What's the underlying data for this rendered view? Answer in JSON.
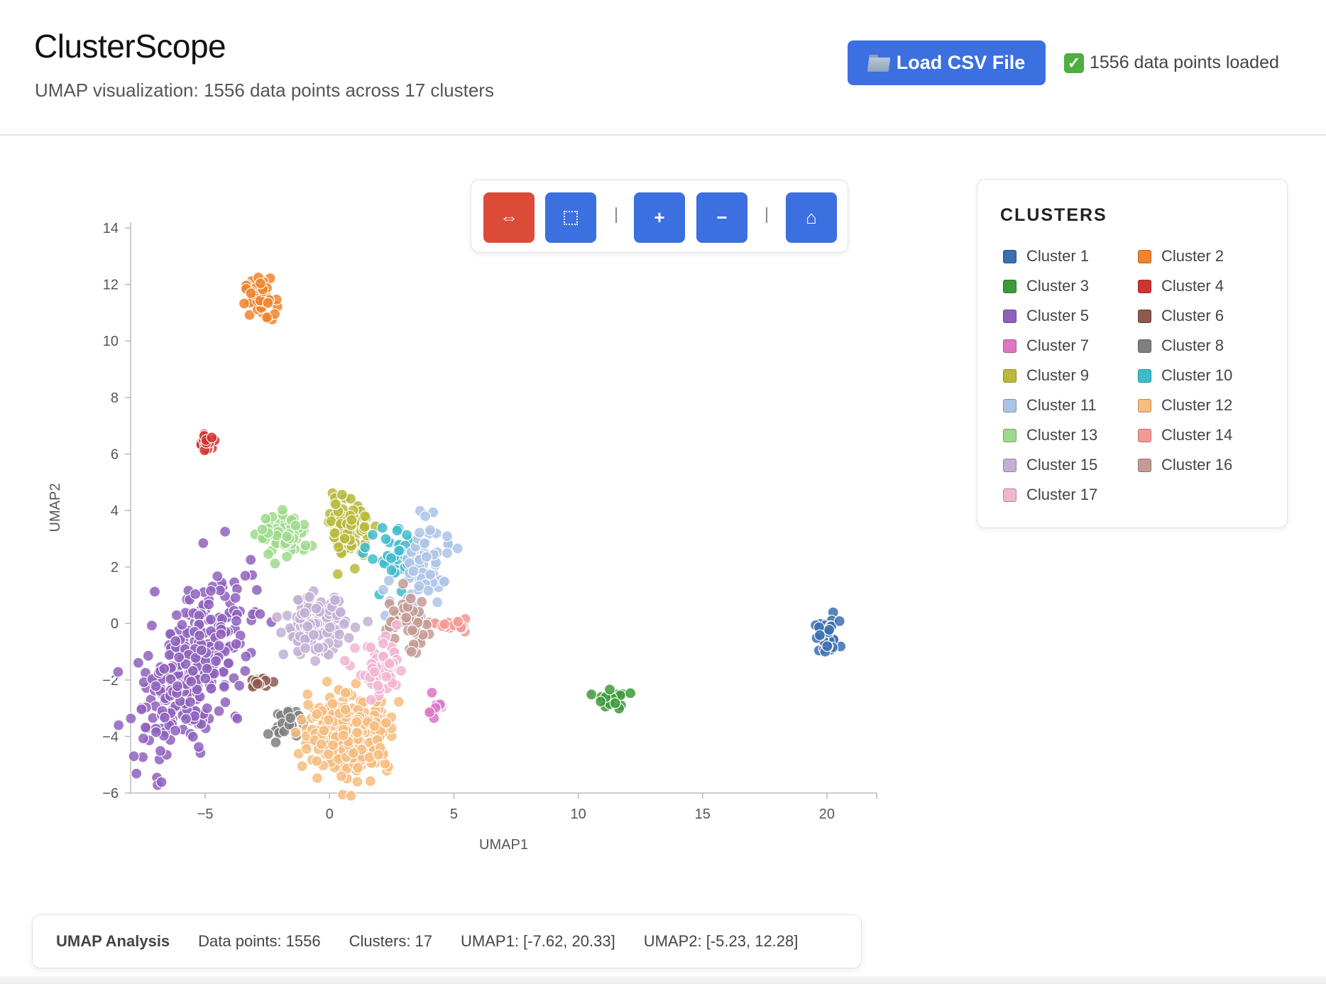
{
  "app": {
    "title": "ClusterScope",
    "subtitle": "UMAP visualization: 1556 data points across 17 clusters"
  },
  "header": {
    "load_button_label": "Load CSV File",
    "load_button_icon": "folder-icon",
    "status_icon": "check-icon",
    "status_text": "1556 data points loaded"
  },
  "toolbar": {
    "buttons": [
      {
        "name": "pan-button",
        "icon": "pan-arrows-icon",
        "glyph": "⇔",
        "color": "#dc4a38"
      },
      {
        "name": "box-select-button",
        "icon": "box-select-icon",
        "glyph": "⬚",
        "color": "#3c6fe0"
      },
      {
        "name": "zoom-in-button",
        "icon": "plus-icon",
        "glyph": "+",
        "color": "#3c6fe0"
      },
      {
        "name": "zoom-out-button",
        "icon": "minus-icon",
        "glyph": "−",
        "color": "#3c6fe0"
      },
      {
        "name": "reset-home-button",
        "icon": "home-icon",
        "glyph": "⌂",
        "color": "#3c6fe0"
      }
    ]
  },
  "legend": {
    "title": "CLUSTERS",
    "items": [
      {
        "label": "Cluster 1",
        "color": "#3a6fb0"
      },
      {
        "label": "Cluster 2",
        "color": "#f0842c"
      },
      {
        "label": "Cluster 3",
        "color": "#3d9a3a"
      },
      {
        "label": "Cluster 4",
        "color": "#cf3530"
      },
      {
        "label": "Cluster 5",
        "color": "#8e61bd"
      },
      {
        "label": "Cluster 6",
        "color": "#8c5a4f"
      },
      {
        "label": "Cluster 7",
        "color": "#dd77c3"
      },
      {
        "label": "Cluster 8",
        "color": "#7f7f7f"
      },
      {
        "label": "Cluster 9",
        "color": "#b9ba3a"
      },
      {
        "label": "Cluster 10",
        "color": "#3fbccb"
      },
      {
        "label": "Cluster 11",
        "color": "#adc4e6"
      },
      {
        "label": "Cluster 12",
        "color": "#f7bc7e"
      },
      {
        "label": "Cluster 13",
        "color": "#9fd98c"
      },
      {
        "label": "Cluster 14",
        "color": "#f39a95"
      },
      {
        "label": "Cluster 15",
        "color": "#c2b0d4"
      },
      {
        "label": "Cluster 16",
        "color": "#c39b93"
      },
      {
        "label": "Cluster 17",
        "color": "#f1b5d1"
      }
    ]
  },
  "footer": {
    "title": "UMAP Analysis",
    "points": "Data points: 1556",
    "clusters": "Clusters: 17",
    "umap1_range": "UMAP1: [-7.62, 20.33]",
    "umap2_range": "UMAP2: [-5.23, 12.28]"
  },
  "chart_data": {
    "type": "scatter",
    "title": "",
    "xlabel": "UMAP1",
    "ylabel": "UMAP2",
    "xlim": [
      -8,
      22
    ],
    "ylim": [
      -6,
      14.2
    ],
    "xticks": [
      -5,
      0,
      5,
      10,
      15,
      20
    ],
    "yticks": [
      -6,
      -4,
      -2,
      0,
      2,
      4,
      6,
      8,
      10,
      12,
      14
    ],
    "grid": false,
    "legend_placement": "right, outside plot",
    "series": [
      {
        "name": "Cluster 1",
        "center": [
          20.0,
          -0.5
        ],
        "spread": [
          0.25,
          0.3
        ],
        "count": 50
      },
      {
        "name": "Cluster 2",
        "center": [
          -2.8,
          11.5
        ],
        "spread": [
          0.3,
          0.35
        ],
        "count": 45
      },
      {
        "name": "Cluster 3",
        "center": [
          11.3,
          -2.7
        ],
        "spread": [
          0.3,
          0.2
        ],
        "count": 20
      },
      {
        "name": "Cluster 4",
        "center": [
          -4.9,
          6.4
        ],
        "spread": [
          0.15,
          0.15
        ],
        "count": 20
      },
      {
        "name": "Cluster 5",
        "center": [
          -5.5,
          -1.5
        ],
        "spread": [
          0.9,
          1.6
        ],
        "count": 310
      },
      {
        "name": "Cluster 6",
        "center": [
          -2.9,
          -2.1
        ],
        "spread": [
          0.25,
          0.1
        ],
        "count": 20
      },
      {
        "name": "Cluster 7",
        "center": [
          4.3,
          -2.9
        ],
        "spread": [
          0.2,
          0.2
        ],
        "count": 15
      },
      {
        "name": "Cluster 8",
        "center": [
          -1.8,
          -3.6
        ],
        "spread": [
          0.3,
          0.25
        ],
        "count": 25
      },
      {
        "name": "Cluster 9",
        "center": [
          0.8,
          3.4
        ],
        "spread": [
          0.4,
          0.55
        ],
        "count": 80
      },
      {
        "name": "Cluster 10",
        "center": [
          2.5,
          2.3
        ],
        "spread": [
          0.5,
          0.5
        ],
        "count": 35
      },
      {
        "name": "Cluster 11",
        "center": [
          3.5,
          1.7
        ],
        "spread": [
          0.6,
          0.8
        ],
        "count": 70
      },
      {
        "name": "Cluster 12",
        "center": [
          0.8,
          -3.9
        ],
        "spread": [
          0.8,
          0.65
        ],
        "count": 330
      },
      {
        "name": "Cluster 13",
        "center": [
          -1.8,
          3.1
        ],
        "spread": [
          0.5,
          0.35
        ],
        "count": 80
      },
      {
        "name": "Cluster 14",
        "center": [
          4.9,
          -0.05
        ],
        "spread": [
          0.3,
          0.1
        ],
        "count": 20
      },
      {
        "name": "Cluster 15",
        "center": [
          -0.6,
          -0.1
        ],
        "spread": [
          0.6,
          0.5
        ],
        "count": 130
      },
      {
        "name": "Cluster 16",
        "center": [
          3.1,
          0.0
        ],
        "spread": [
          0.5,
          0.5
        ],
        "count": 45
      },
      {
        "name": "Cluster 17",
        "center": [
          2.1,
          -1.7
        ],
        "spread": [
          0.5,
          0.5
        ],
        "count": 55
      }
    ]
  }
}
